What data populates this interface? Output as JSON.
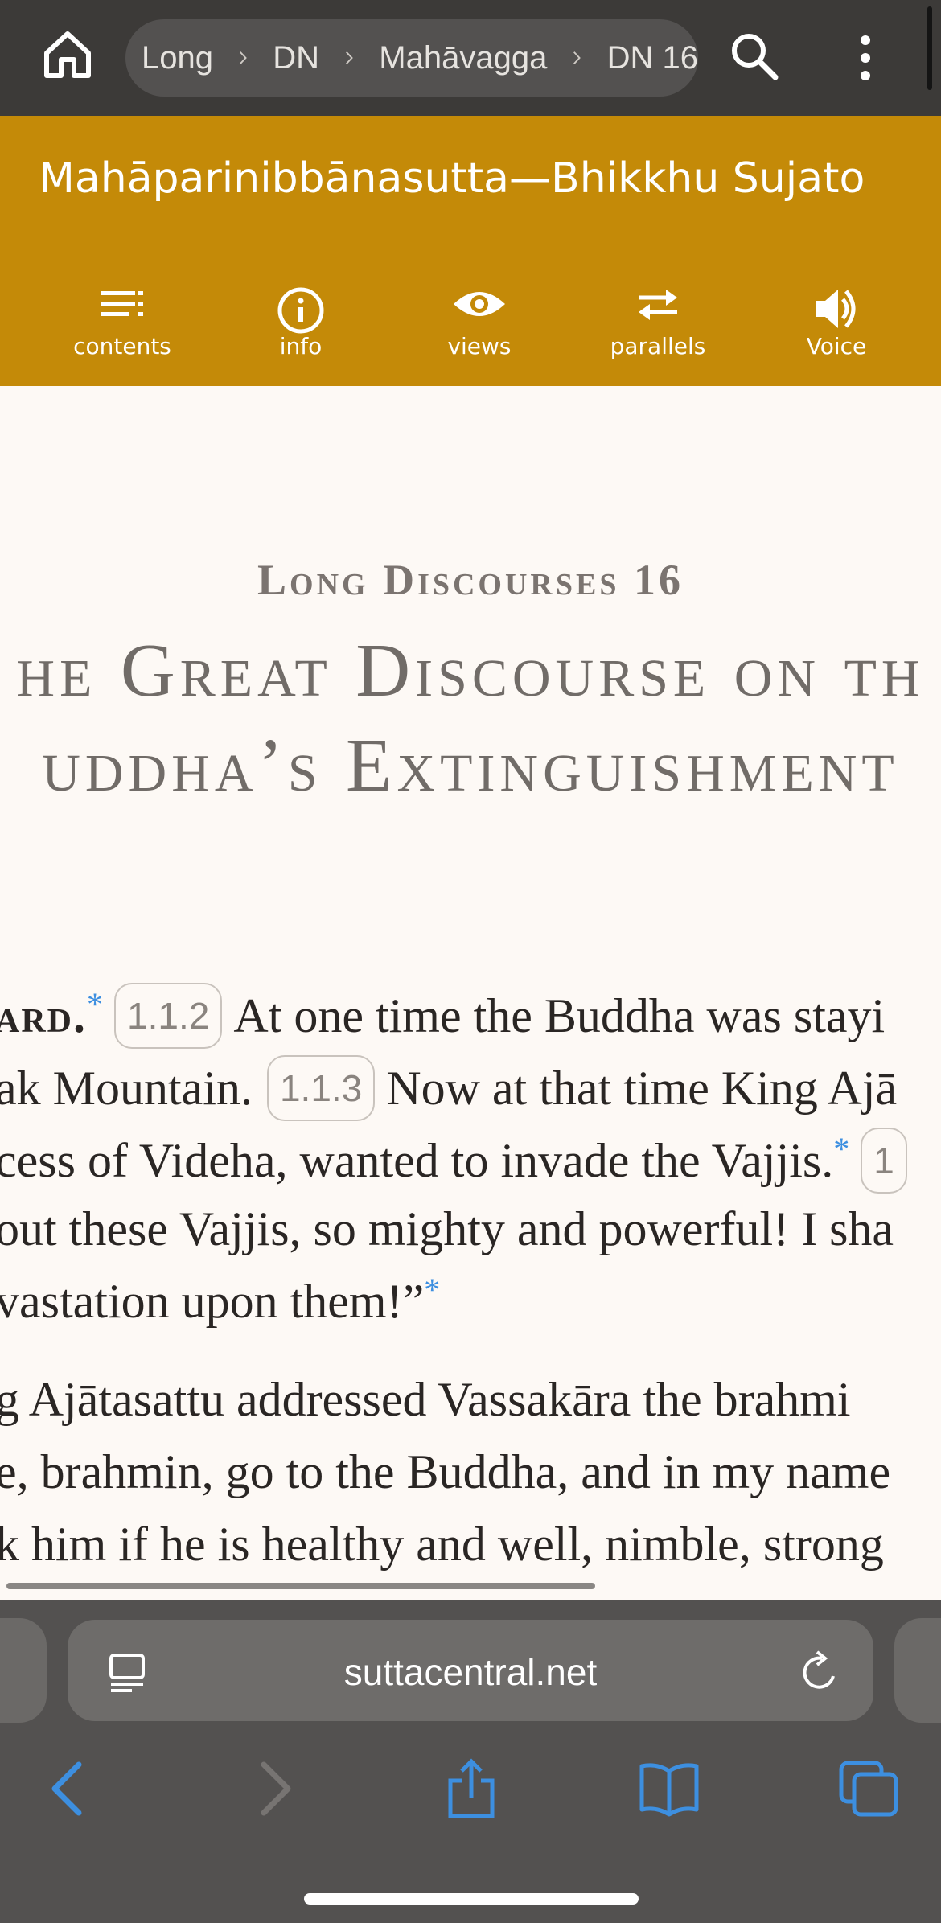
{
  "topbar": {
    "breadcrumb": [
      "Long",
      "DN",
      "Mahāvagga",
      "DN 16"
    ]
  },
  "header": {
    "title": "Mahāparinibbānasutta—Bhikkhu Sujato",
    "tools": [
      {
        "label": "contents",
        "icon": "contents-icon"
      },
      {
        "label": "info",
        "icon": "info-icon"
      },
      {
        "label": "views",
        "icon": "eye-icon"
      },
      {
        "label": "parallels",
        "icon": "parallels-icon"
      },
      {
        "label": "Voice",
        "icon": "speaker-icon"
      }
    ]
  },
  "content": {
    "collection": "Long Discourses 16",
    "title_line1": "he Great Discourse on th",
    "title_line2": "uddha’s Extinguishment",
    "lines": [
      {
        "pre_smcap": "ard.",
        "note": "*",
        "ref": "1.1.2",
        "text": "At one time the Buddha was stayi"
      },
      {
        "text": "ak Mountain.",
        "ref": "1.1.3",
        "after": "Now at that time King Ajā"
      },
      {
        "text": "cess of Videha, wanted to invade the Vajjis.",
        "note": "*",
        "ref": "1"
      },
      {
        "text": "out these Vajjis, so mighty and powerful! I sha"
      },
      {
        "text": "vastation upon them!”",
        "note": "*"
      },
      {
        "text": "g Ajātasattu addressed Vassakāra the brahmi"
      },
      {
        "text": "e, brahmin, go to the Buddha, and in my name"
      },
      {
        "text": "k him if he is healthy and well, nimble, strong"
      }
    ]
  },
  "browser": {
    "url": "suttacentral.net"
  },
  "colors": {
    "topbar": "#3c3a38",
    "header": "#c48a08",
    "page": "#fdf9f5",
    "note_link": "#3d8fe0",
    "ios_blue": "#3d8fe0"
  }
}
